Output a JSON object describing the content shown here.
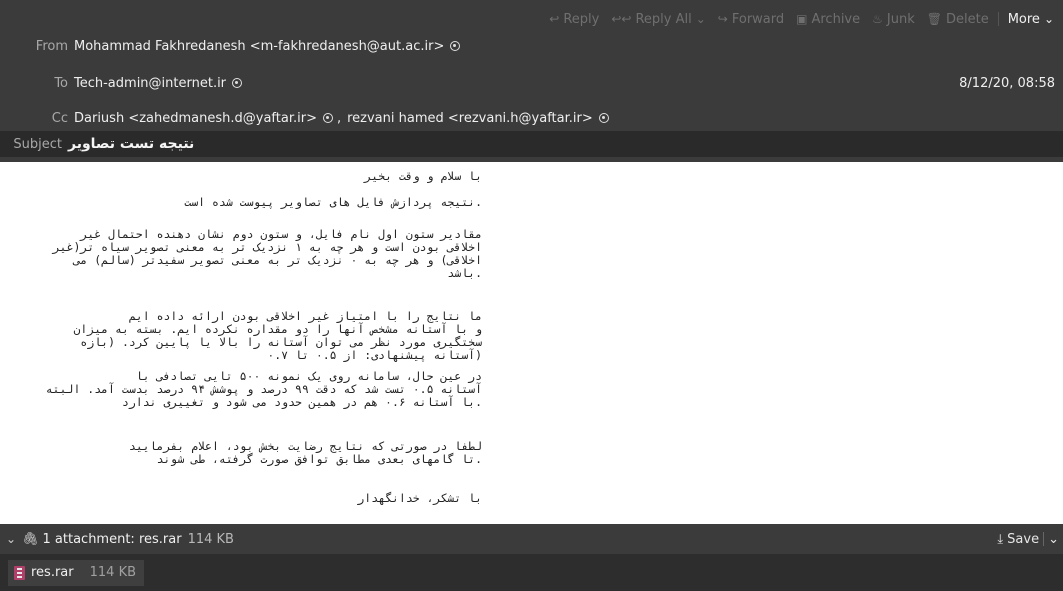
{
  "toolbar": {
    "reply": "Reply",
    "reply_all": "Reply All",
    "forward": "Forward",
    "archive": "Archive",
    "junk": "Junk",
    "delete": "Delete",
    "more": "More"
  },
  "header": {
    "from_label": "From",
    "from_value": "Mohammad Fakhredanesh <m-fakhredanesh@aut.ac.ir>",
    "to_label": "To",
    "to_value": "Tech-admin@internet.ir",
    "date": "8/12/20, 08:58",
    "cc_label": "Cc",
    "cc_value_1": "Dariush <zahedmanesh.d@yaftar.ir>",
    "cc_value_2": "rezvani hamed <rezvani.h@yaftar.ir>",
    "subject_label": "Subject",
    "subject_value": "نتیجه تست تصاویر"
  },
  "body": {
    "greeting": "با سلام و وقت بخیر",
    "line1": ".نتیجه پردازش فایل های تصاویر پیوست شده است",
    "p1": "مقادیر ستون اول نام فایل، و ستون دوم نشان دهنده احتمال غیر\nاخلاقی بودن است و هر چه به ۱ نزدیک تر به معنی تصویر سیاه تر(غیر\nاخلاقی) و هر چه به ۰ نزدیک تر به معنی تصویر سفیدتر (سالم) می\n.باشد",
    "p2": "ما نتایج را با امتیاز غیر اخلاقی بودن ارائه داده ایم\nو با آستانه مشخص آنها را دو مقداره نکرده ایم. بسته به میزان\nسختگیری مورد نظر می توان آستانه را بالا یا پایین کرد. (بازه\n(آستانه پیشنهادی: از ۰.۵ تا ۰.۷",
    "p3": "در عین حال، سامانه روی یک نمونه ۵۰۰ تایی تصادفی با\nآستانه ۰.۵ تست شد که دقت ۹۹ درصد و پوشش ۹۴ درصد بدست آمد. البته\n.با آستانه ۰.۶ هم در همین حدود می شود و تغییری ندارد",
    "p4": "لطفا در صورتی که نتایج رضایت بخش بود، اعلام بفرمایید\n.تا گامهای بعدی مطابق توافق صورت گرفته، طی شوند",
    "closing": "با تشکر، خدانگهدار"
  },
  "attachments": {
    "summary": "1 attachment: res.rar",
    "summary_size": "114 KB",
    "save_label": "Save",
    "item_name": "res.rar",
    "item_size": "114 KB"
  },
  "colors": {
    "header_bg": "#3b3b3b",
    "subject_bg": "#2a2a2a",
    "attachment_list_bg": "#2d2d2d",
    "body_bg": "#ffffff",
    "rar_icon": "#b0406a"
  }
}
